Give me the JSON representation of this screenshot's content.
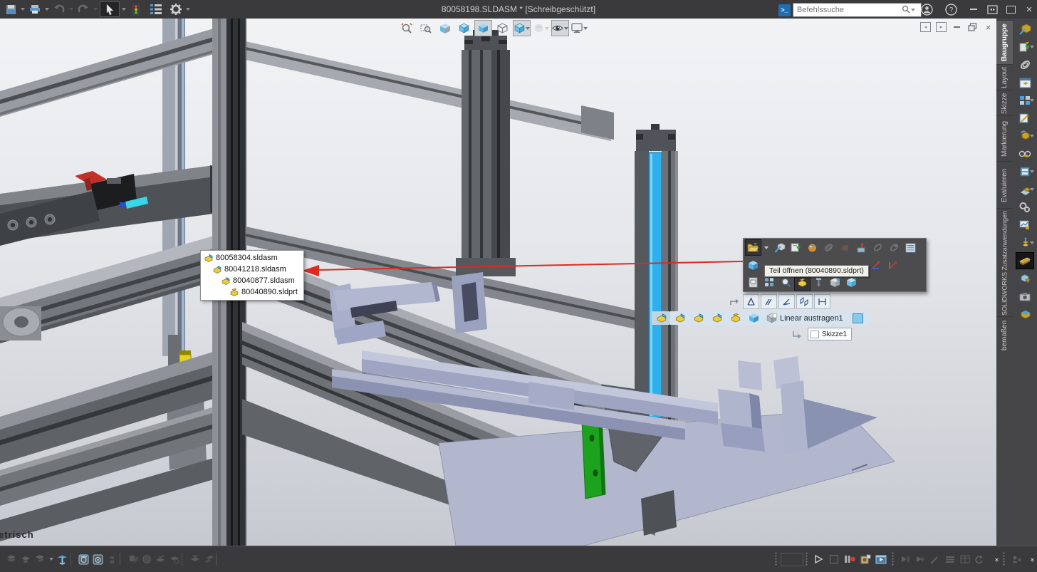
{
  "titlebar": {
    "title": "80058198.SLDASM * [Schreibgeschützt]",
    "search_placeholder": "Befehlssuche",
    "left_icons": [
      "save",
      "print",
      "undo",
      "redo",
      "select-arrow",
      "rebuild-traffic-light",
      "display-settings-list",
      "options-gear"
    ],
    "right_icons": [
      "user-account",
      "help",
      "minimize",
      "arrange-windows",
      "maximize",
      "close"
    ]
  },
  "headsup_toolbar": {
    "items": [
      {
        "name": "zoom-to-fit"
      },
      {
        "name": "zoom-to-area"
      },
      {
        "name": "section-view"
      },
      {
        "name": "view-orientation-cube"
      },
      {
        "name": "display-style-shaded",
        "pressed": true
      },
      {
        "name": "display-style-wireframe"
      },
      {
        "name": "view-orientation-dropdown",
        "pressed": true
      },
      {
        "name": "edit-appearance",
        "disabled": true
      },
      {
        "name": "hide-show-items-eye",
        "pressed": true
      },
      {
        "name": "view-settings-monitor"
      }
    ]
  },
  "doc_window_controls": [
    "pane-left",
    "pane-right",
    "minimize",
    "restore",
    "close"
  ],
  "viewport": {
    "view_label": "etrisch",
    "bg_top": "#f2f3f5",
    "bg_bottom": "#c6c9d0",
    "selection_color": "#2fb0ec",
    "green_part_color": "#1ca21c",
    "yellow_part_color": "#e6d31a",
    "arrow_color": "#dd2b20"
  },
  "hierarchy_popup": {
    "items": [
      {
        "label": "80058304.sldasm",
        "type": "assembly"
      },
      {
        "label": "80041218.sldasm",
        "type": "assembly"
      },
      {
        "label": "80040877.sldasm",
        "type": "assembly"
      },
      {
        "label": "80040890.sldprt",
        "type": "part"
      }
    ]
  },
  "context_toolbar": {
    "tooltip": "Teil öffnen (80040890.sldprt)",
    "row1": [
      "open-part",
      "open-part-dropdown",
      "edit-part",
      "make-virtual",
      "appearance",
      "mate",
      "fix",
      "isolate",
      "suppress",
      "attach",
      "list-selection"
    ],
    "row2": [
      "view-cube",
      "axis-1",
      "axis-2"
    ],
    "row3": [
      "open-drawing",
      "component-pattern",
      "magnify-selection",
      "selected-part",
      "pin",
      "configure-1",
      "configure-2"
    ]
  },
  "quick_mates": [
    "coincident-mate",
    "parallel-mate",
    "angle-mate",
    "parallel-planes-mate",
    "width-mate"
  ],
  "breadcrumb": {
    "segments": [
      "assembly",
      "assembly",
      "assembly",
      "assembly",
      "part",
      "solid-body",
      "feature"
    ],
    "feature_label": "Linear austragen1",
    "tail": "sketch-plane",
    "sketch_label": "Skizze1"
  },
  "right_panel": {
    "tabs": [
      {
        "label": "Baugruppe",
        "active": true
      },
      {
        "label": "Layout",
        "active": false
      },
      {
        "label": "Skizze",
        "active": false
      },
      {
        "label": "Markierung",
        "active": false
      },
      {
        "label": "Evaluieren",
        "active": false
      },
      {
        "label": "SOLIDWORKS Zusatzanwendungen",
        "active": false
      },
      {
        "label": "bemaßen",
        "active": false
      }
    ],
    "icons": [
      "edit-component",
      "insert-component",
      "mate",
      "component-preview",
      "linear-pattern",
      "smart-fasteners",
      "move-component",
      "show-hidden-components",
      "assembly-features",
      "reference-geometry",
      "belt-chain",
      "motion-study",
      "exploded-view",
      "instant3d",
      "interference-detection",
      "take-snapshot",
      "large-design-review"
    ],
    "pressed_icon": "instant3d"
  },
  "bottom_toolbar": {
    "left_icons": [
      "filter-1",
      "filter-2",
      "filter-3",
      "filter-dropdown",
      "selection-anchor",
      "box-tool-1",
      "box-tool-2",
      "grid-88",
      "tool-1",
      "tool-2",
      "tool-3",
      "tool-4",
      "tool-5",
      "tool-6"
    ],
    "right_icons": [
      "drag-dots",
      "timeline-box",
      "drag-dots",
      "play",
      "stop",
      "record",
      "save-animation",
      "video-settings",
      "key-1",
      "key-2",
      "pencil",
      "lines",
      "table",
      "refresh",
      "expand-chevron",
      "drag-dots",
      "collaborate",
      "expand-chevron-2"
    ]
  }
}
